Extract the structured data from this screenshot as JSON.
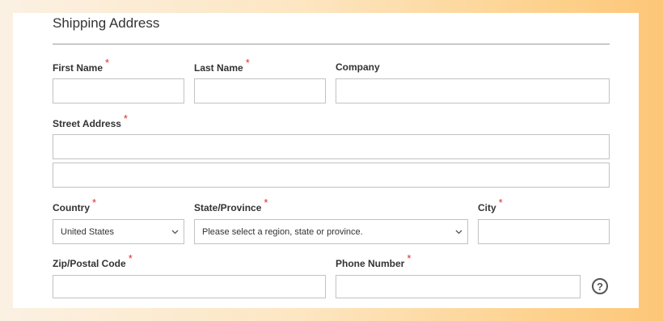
{
  "form": {
    "section_title": "Shipping Address",
    "required_marker": "*",
    "fields": {
      "first_name": {
        "label": "First Name",
        "value": ""
      },
      "last_name": {
        "label": "Last Name",
        "value": ""
      },
      "company": {
        "label": "Company",
        "value": ""
      },
      "street_address": {
        "label": "Street Address",
        "line1": "",
        "line2": ""
      },
      "country": {
        "label": "Country",
        "selected": "United States"
      },
      "state": {
        "label": "State/Province",
        "selected": "Please select a region, state or province."
      },
      "city": {
        "label": "City",
        "value": ""
      },
      "zip": {
        "label": "Zip/Postal Code",
        "value": ""
      },
      "phone": {
        "label": "Phone Number",
        "value": "",
        "help_icon": "question-circle-icon"
      }
    }
  },
  "colors": {
    "required": "#e02b27",
    "border": "#c2c2c2",
    "frame_gradient_end": "#fdc678"
  }
}
